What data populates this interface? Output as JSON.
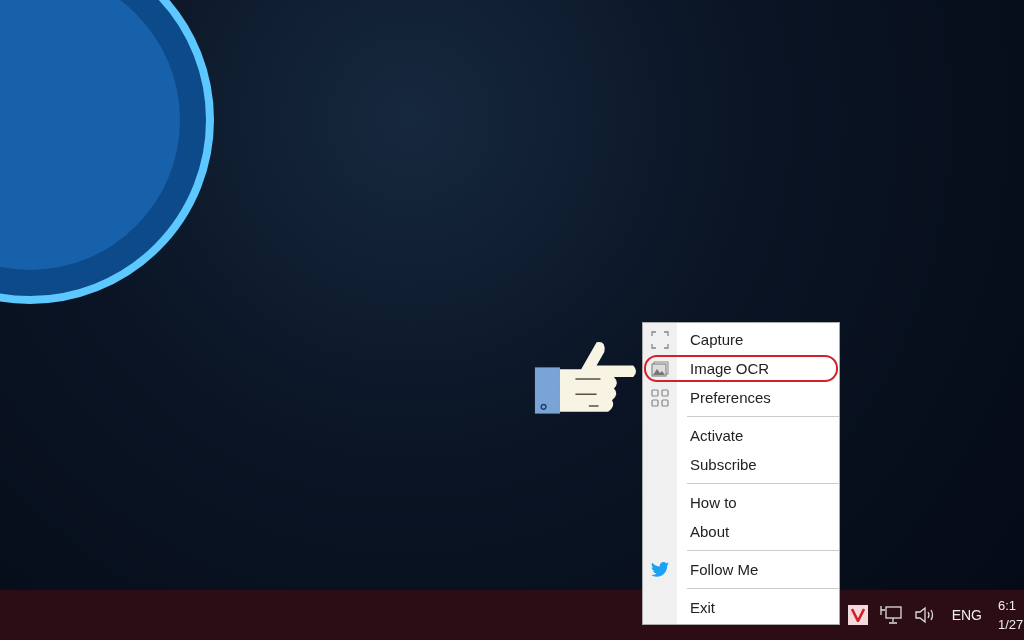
{
  "context_menu": {
    "items": [
      {
        "kind": "item",
        "label": "Capture",
        "highlighted": false
      },
      {
        "kind": "item",
        "label": "Image OCR",
        "highlighted": true
      },
      {
        "kind": "item",
        "label": "Preferences",
        "highlighted": false
      },
      {
        "kind": "separator"
      },
      {
        "kind": "item",
        "label": "Activate",
        "highlighted": false
      },
      {
        "kind": "item",
        "label": "Subscribe",
        "highlighted": false
      },
      {
        "kind": "separator"
      },
      {
        "kind": "item",
        "label": "How to",
        "highlighted": false
      },
      {
        "kind": "item",
        "label": "About",
        "highlighted": false
      },
      {
        "kind": "separator"
      },
      {
        "kind": "item",
        "label": "Follow Me",
        "highlighted": false
      },
      {
        "kind": "separator"
      },
      {
        "kind": "item",
        "label": "Exit",
        "highlighted": false
      }
    ]
  },
  "taskbar": {
    "tray": {
      "language": "ENG",
      "time": "6:1",
      "date": "1/27"
    }
  }
}
